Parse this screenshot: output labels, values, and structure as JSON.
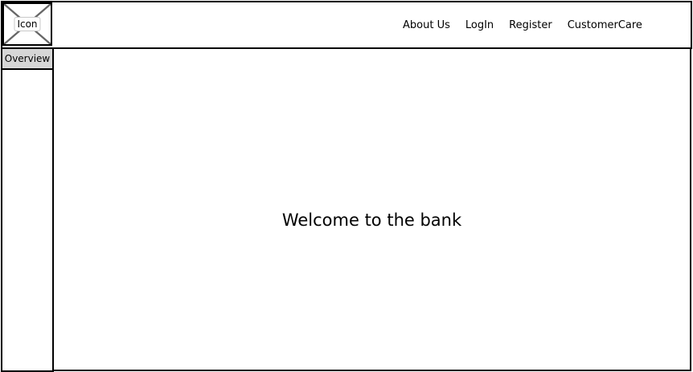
{
  "logo": {
    "label": "Icon",
    "icon": "image-placeholder-icon"
  },
  "nav": {
    "items": [
      {
        "label": "About Us"
      },
      {
        "label": "LogIn"
      },
      {
        "label": "Register"
      },
      {
        "label": "CustomerCare"
      }
    ]
  },
  "sidebar": {
    "items": [
      {
        "label": "Overview",
        "selected": true
      }
    ]
  },
  "main": {
    "heading": "Welcome to the bank"
  },
  "colors": {
    "border": "#000000",
    "background": "#ffffff",
    "sidebar_selected": "#d6d6d6",
    "placeholder_cross": "#666666"
  }
}
